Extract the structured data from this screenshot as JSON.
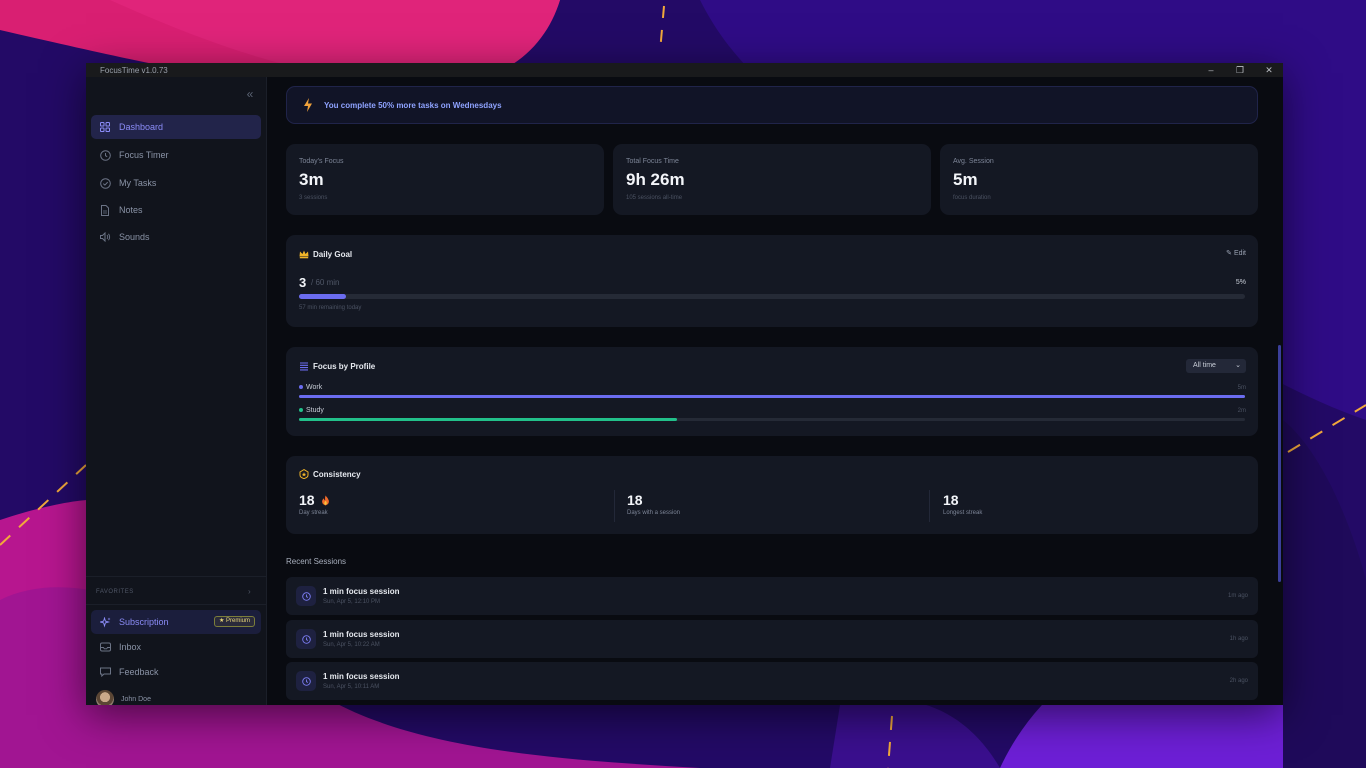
{
  "window": {
    "title": "FocusTime v1.0.73",
    "controls": [
      "minimize-icon",
      "restore-icon",
      "close-icon"
    ]
  },
  "sidebar": {
    "items": [
      {
        "label": "Dashboard",
        "icon": "grid-icon",
        "active": true
      },
      {
        "label": "Focus Timer",
        "icon": "clock-icon",
        "active": false
      },
      {
        "label": "My Tasks",
        "icon": "check-circle-icon",
        "active": false
      },
      {
        "label": "Notes",
        "icon": "document-icon",
        "active": false
      },
      {
        "label": "Sounds",
        "icon": "speaker-icon",
        "active": false
      }
    ],
    "favorites_label": "FAVORITES",
    "bottom": {
      "subscription": {
        "label": "Subscription",
        "badge": "Premium"
      },
      "inbox": "Inbox",
      "feedback": "Feedback",
      "user_name": "John Doe"
    }
  },
  "insight": {
    "text": "You complete 50% more tasks on Wednesdays"
  },
  "stats": [
    {
      "label": "Today's Focus",
      "value": "3m",
      "sub": "3 sessions"
    },
    {
      "label": "Total Focus Time",
      "value": "9h 26m",
      "sub": "105 sessions all-time"
    },
    {
      "label": "Avg. Session",
      "value": "5m",
      "sub": "focus duration"
    }
  ],
  "daily_goal": {
    "title": "Daily Goal",
    "edit_label": "Edit",
    "current": "3",
    "target": "/ 60 min",
    "percent_label": "5%",
    "progress": 0.05,
    "remaining": "57 min remaining today"
  },
  "focus_by_profile": {
    "title": "Focus by Profile",
    "filter": "All time",
    "profiles": [
      {
        "name": "Work",
        "value": "5m",
        "fraction": 1.0,
        "color": "#6b6cf0"
      },
      {
        "name": "Study",
        "value": "2m",
        "fraction": 0.4,
        "color": "#22c08a"
      }
    ]
  },
  "consistency": {
    "title": "Consistency",
    "items": [
      {
        "value": "18",
        "label": "Day streak"
      },
      {
        "value": "18",
        "label": "Days with a session"
      },
      {
        "value": "18",
        "label": "Longest streak"
      }
    ]
  },
  "recent_sessions": {
    "title": "Recent Sessions",
    "items": [
      {
        "title": "1 min focus session",
        "date": "Sun, Apr 5, 12:10 PM",
        "ago": "1m ago"
      },
      {
        "title": "1 min focus session",
        "date": "Sun, Apr 5, 10:22 AM",
        "ago": "1h ago"
      },
      {
        "title": "1 min focus session",
        "date": "Sun, Apr 5, 10:11 AM",
        "ago": "2h ago"
      }
    ]
  },
  "colors": {
    "accent": "#6b6cf0",
    "success": "#22c08a",
    "gold": "#f0b429",
    "background": "#090b11",
    "card": "#141823"
  }
}
